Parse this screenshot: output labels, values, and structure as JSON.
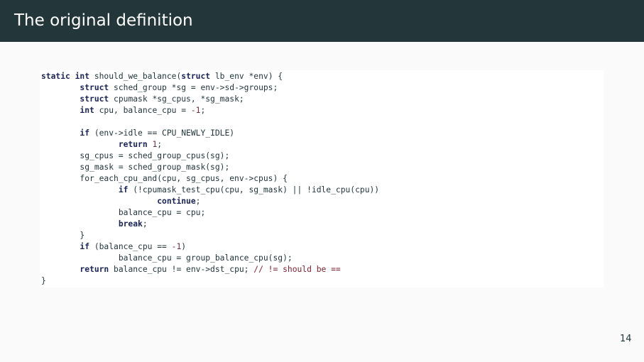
{
  "slide": {
    "title": "The original definition",
    "page_number": "14"
  },
  "code": {
    "language": "c",
    "lines": [
      [
        {
          "t": "kw",
          "v": "static"
        },
        {
          "t": "txt",
          "v": " "
        },
        {
          "t": "kw",
          "v": "int"
        },
        {
          "t": "txt",
          "v": " should_we_balance("
        },
        {
          "t": "kw",
          "v": "struct"
        },
        {
          "t": "txt",
          "v": " lb_env *env) {"
        }
      ],
      [
        {
          "t": "txt",
          "v": "        "
        },
        {
          "t": "kw",
          "v": "struct"
        },
        {
          "t": "txt",
          "v": " sched_group *sg = env->sd->groups;"
        }
      ],
      [
        {
          "t": "txt",
          "v": "        "
        },
        {
          "t": "kw",
          "v": "struct"
        },
        {
          "t": "txt",
          "v": " cpumask *sg_cpus, *sg_mask;"
        }
      ],
      [
        {
          "t": "txt",
          "v": "        "
        },
        {
          "t": "kw",
          "v": "int"
        },
        {
          "t": "txt",
          "v": " cpu, balance_cpu = "
        },
        {
          "t": "num",
          "v": "-1"
        },
        {
          "t": "txt",
          "v": ";"
        }
      ],
      [],
      [
        {
          "t": "txt",
          "v": "        "
        },
        {
          "t": "kw",
          "v": "if"
        },
        {
          "t": "txt",
          "v": " (env->idle == CPU_NEWLY_IDLE)"
        }
      ],
      [
        {
          "t": "txt",
          "v": "                "
        },
        {
          "t": "kw",
          "v": "return"
        },
        {
          "t": "txt",
          "v": " "
        },
        {
          "t": "num",
          "v": "1"
        },
        {
          "t": "txt",
          "v": ";"
        }
      ],
      [
        {
          "t": "txt",
          "v": "        sg_cpus = sched_group_cpus(sg);"
        }
      ],
      [
        {
          "t": "txt",
          "v": "        sg_mask = sched_group_mask(sg);"
        }
      ],
      [
        {
          "t": "txt",
          "v": "        for_each_cpu_and(cpu, sg_cpus, env->cpus) {"
        }
      ],
      [
        {
          "t": "txt",
          "v": "                "
        },
        {
          "t": "kw",
          "v": "if"
        },
        {
          "t": "txt",
          "v": " (!cpumask_test_cpu(cpu, sg_mask) || !idle_cpu(cpu))"
        }
      ],
      [
        {
          "t": "txt",
          "v": "                        "
        },
        {
          "t": "kw",
          "v": "continue"
        },
        {
          "t": "txt",
          "v": ";"
        }
      ],
      [
        {
          "t": "txt",
          "v": "                balance_cpu = cpu;"
        }
      ],
      [
        {
          "t": "txt",
          "v": "                "
        },
        {
          "t": "kw",
          "v": "break"
        },
        {
          "t": "txt",
          "v": ";"
        }
      ],
      [
        {
          "t": "txt",
          "v": "        }"
        }
      ],
      [
        {
          "t": "txt",
          "v": "        "
        },
        {
          "t": "kw",
          "v": "if"
        },
        {
          "t": "txt",
          "v": " (balance_cpu == "
        },
        {
          "t": "num",
          "v": "-1"
        },
        {
          "t": "txt",
          "v": ")"
        }
      ],
      [
        {
          "t": "txt",
          "v": "                balance_cpu = group_balance_cpu(sg);"
        }
      ],
      [
        {
          "t": "txt",
          "v": "        "
        },
        {
          "t": "kw",
          "v": "return"
        },
        {
          "t": "txt",
          "v": " balance_cpu != env->dst_cpu; "
        },
        {
          "t": "cmt",
          "v": "// != should be =="
        }
      ],
      [
        {
          "t": "txt",
          "v": "}"
        }
      ]
    ]
  }
}
